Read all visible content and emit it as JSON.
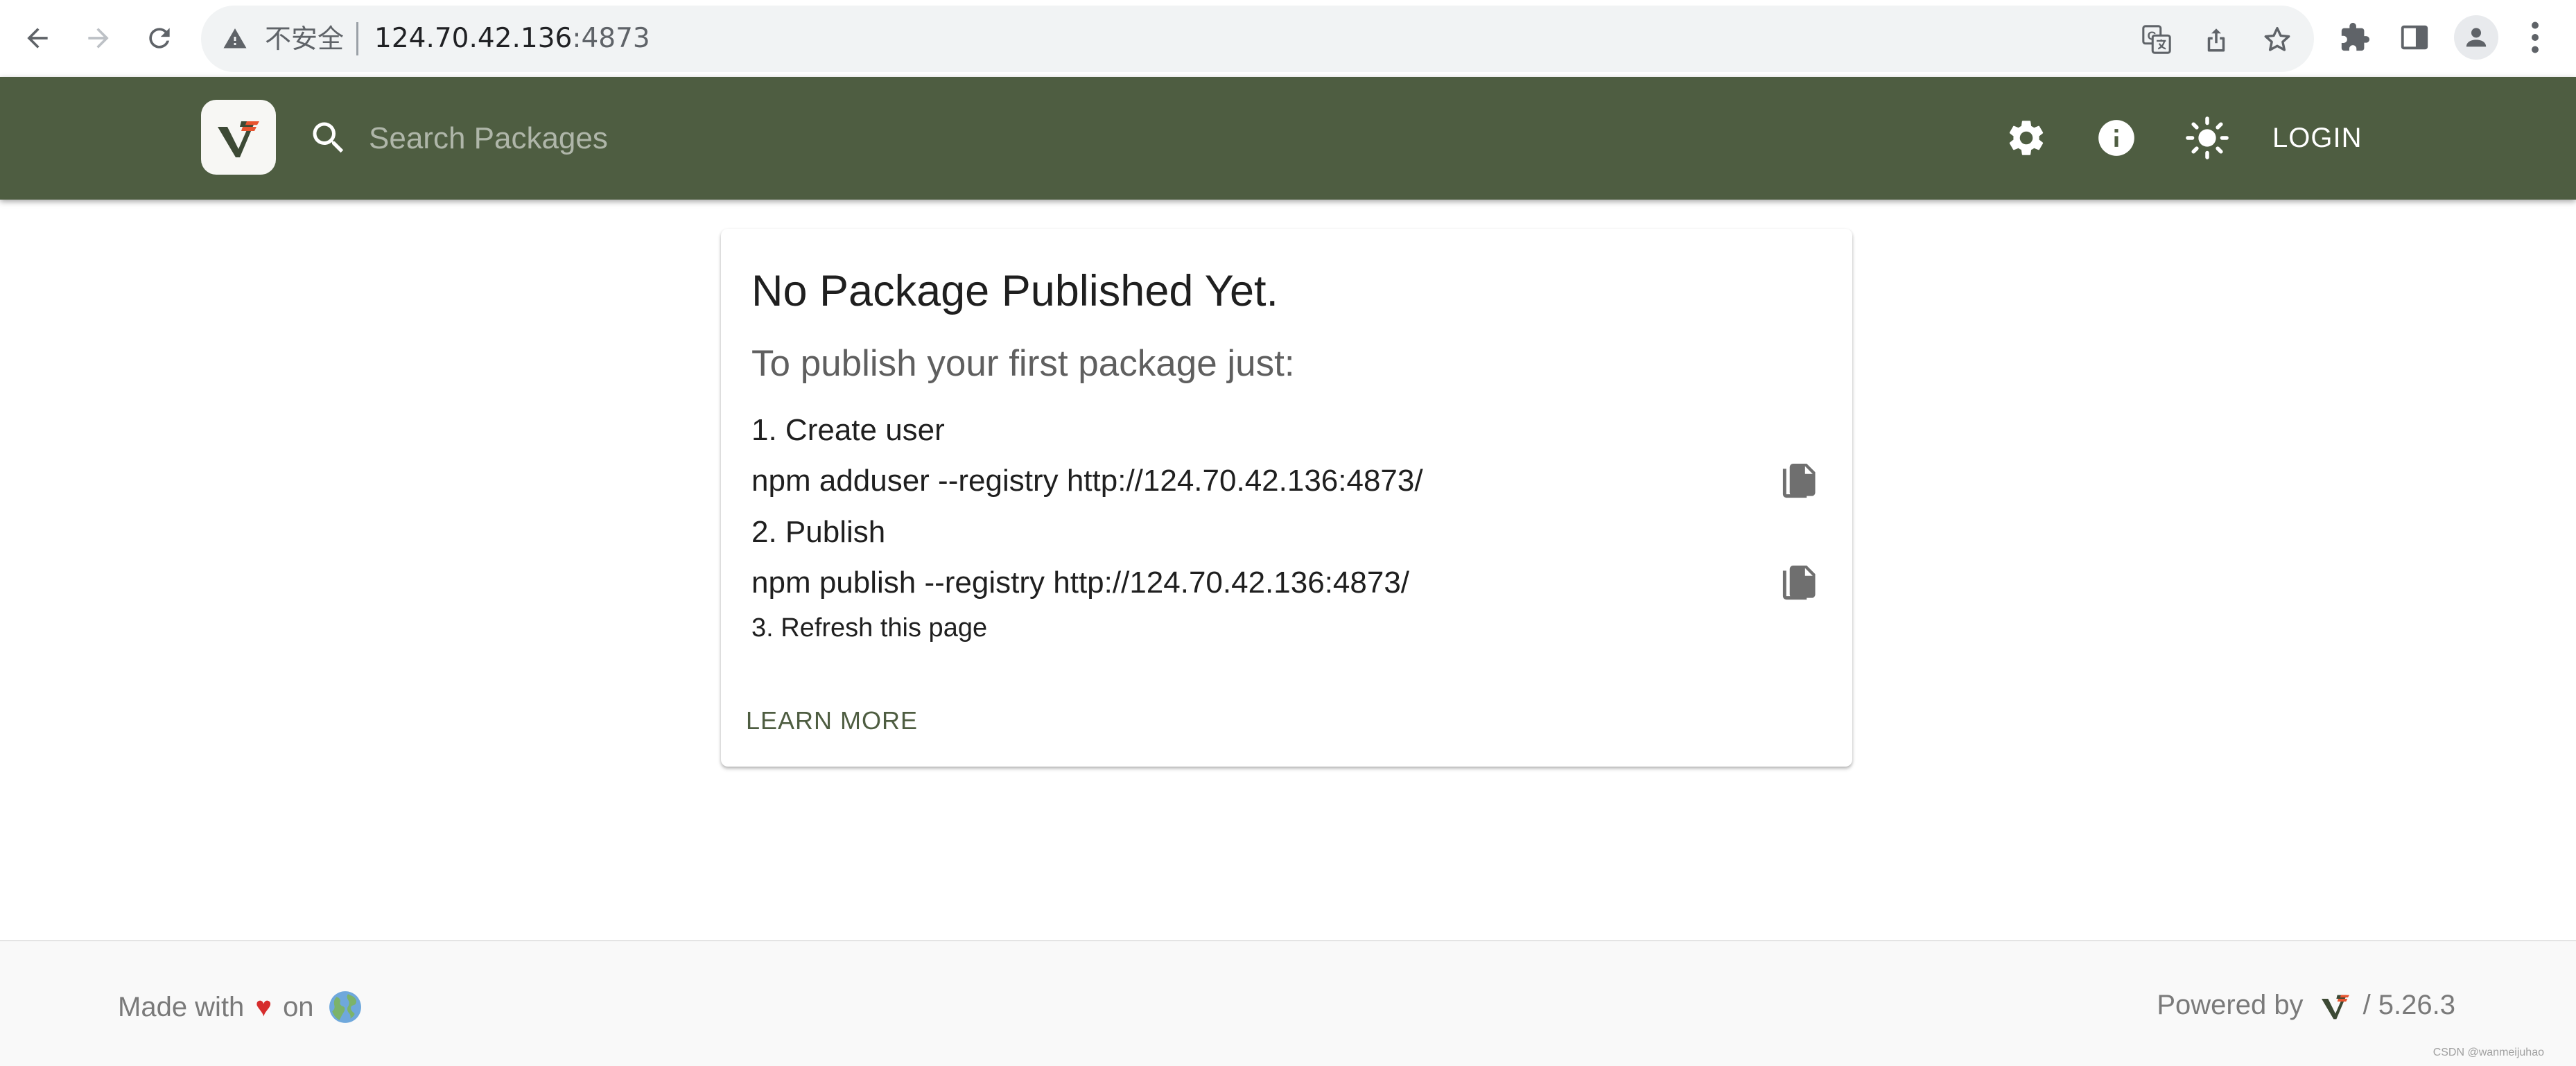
{
  "browser": {
    "security_label": "不安全",
    "url_host": "124.70.42.136",
    "url_port": ":4873"
  },
  "header": {
    "search_placeholder": "Search Packages",
    "login_label": "LOGIN"
  },
  "card": {
    "title": "No Package Published Yet.",
    "subtitle": "To publish your first package just:",
    "steps": [
      {
        "label": "1. Create user",
        "command": "npm adduser --registry http://124.70.42.136:4873/"
      },
      {
        "label": "2. Publish",
        "command": "npm publish --registry http://124.70.42.136:4873/"
      }
    ],
    "refresh_label": "3. Refresh this page",
    "learn_more_label": "LEARN MORE"
  },
  "footer": {
    "made_with": "Made with",
    "heart": "♥",
    "on": "on",
    "powered_by": "Powered by",
    "version": "/ 5.26.3",
    "watermark": "CSDN @wanmeijuhao"
  },
  "colors": {
    "header_bg": "#4e5d41",
    "accent": "#4e5d41",
    "heart": "#d62d2d"
  },
  "icons": {
    "back": "arrow-left-icon",
    "forward": "arrow-right-icon",
    "reload": "reload-icon",
    "warning": "warning-triangle-icon",
    "translate": "translate-icon",
    "share": "share-icon",
    "bookmark": "star-icon",
    "extensions": "puzzle-icon",
    "side_panel": "side-panel-icon",
    "profile": "profile-avatar-icon",
    "menu": "kebab-menu-icon",
    "logo": "verdaccio-logo",
    "search": "search-icon",
    "settings": "gear-icon",
    "info": "info-icon",
    "theme": "sun-icon",
    "copy": "copy-icon",
    "globe": "globe-icon"
  }
}
